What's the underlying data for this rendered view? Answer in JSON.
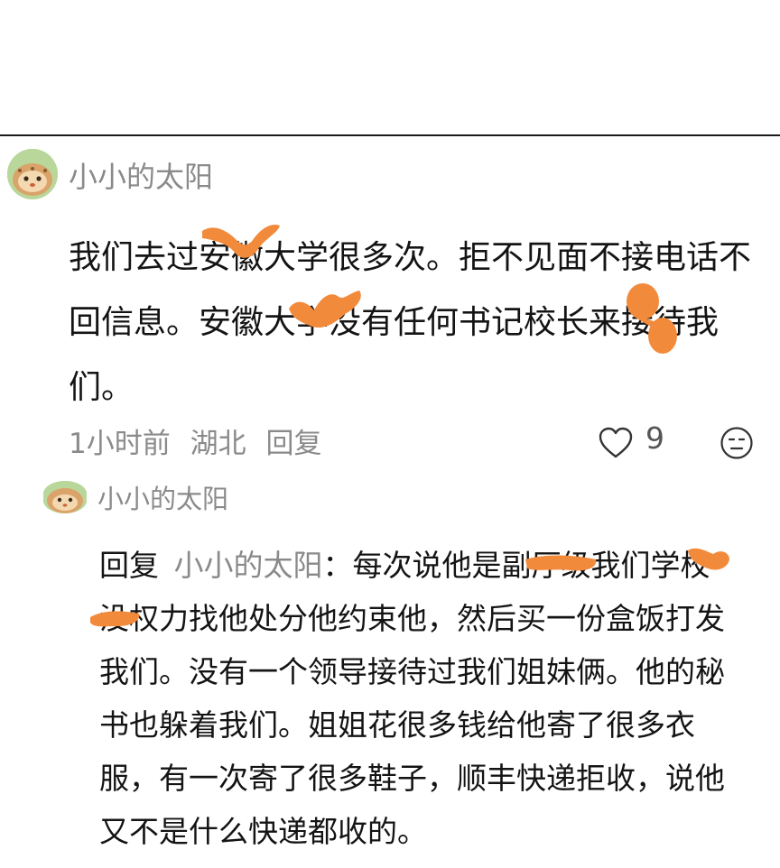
{
  "comment": {
    "username": "小小的太阳",
    "text": "我们去过安徽大学很多次。拒不见面不接电话不回信息。安徽大学没有任何书记校长来接待我们。",
    "time": "1小时前",
    "location": "湖北",
    "reply_label": "回复",
    "like_count": "9"
  },
  "reply": {
    "username": "小小的太阳",
    "prefix": "回复",
    "target": "小小的太阳",
    "separator": "：",
    "text": "每次说他是副厅级我们学校没权力找他处分他约束他，然后买一份盒饭打发我们。没有一个领导接待过我们姐妹俩。他的秘书也躲着我们。姐姐花很多钱给他寄了很多衣服，有一次寄了很多鞋子，顺丰快递拒收，说他又不是什么快递都收的。"
  },
  "colors": {
    "redaction": "#f28a3c",
    "meta_text": "#8a8a8a",
    "body_text": "#141414",
    "avatar_bg": "#b9d79a"
  },
  "icons": [
    "heart-icon",
    "emoji-icon"
  ]
}
